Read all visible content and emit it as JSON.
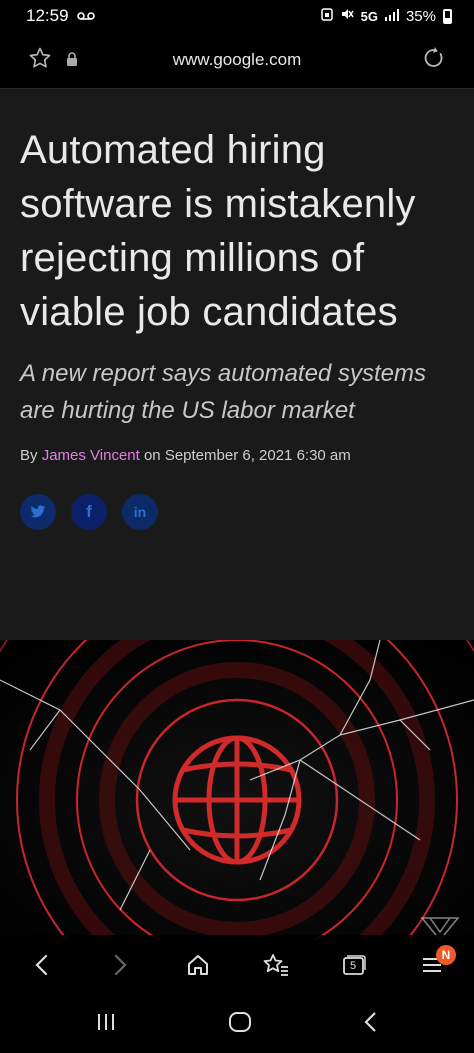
{
  "status_bar": {
    "time": "12:59",
    "voicemail_icon": "voicemail-icon",
    "network": "5G",
    "battery": "35%"
  },
  "browser": {
    "url": "www.google.com",
    "favorite_icon": "star-icon",
    "secure_icon": "lock-icon",
    "reload_icon": "reload-icon"
  },
  "article": {
    "headline": "Automated hiring software is mistakenly rejecting millions of viable job candidates",
    "dek": "A new report says automated systems are hurting the US labor market",
    "byline_prefix": "By ",
    "author": "James Vincent",
    "byline_suffix": " on September 6, 2021 6:30 am",
    "share_buttons": [
      {
        "network": "twitter",
        "glyph": "🐦",
        "icon": "twitter-icon"
      },
      {
        "network": "facebook",
        "glyph": "f",
        "icon": "facebook-icon"
      },
      {
        "network": "linkedin",
        "glyph": "in",
        "icon": "linkedin-icon"
      }
    ],
    "hero_image": "globe-cracked-glass-image"
  },
  "bottom_toolbar": {
    "tabs_count": "5",
    "menu_badge": "N"
  },
  "colors": {
    "article_bg": "#1a1a1a",
    "author_link": "#e67ce8",
    "hero_red": "#c8262a",
    "badge": "#f05a28"
  }
}
